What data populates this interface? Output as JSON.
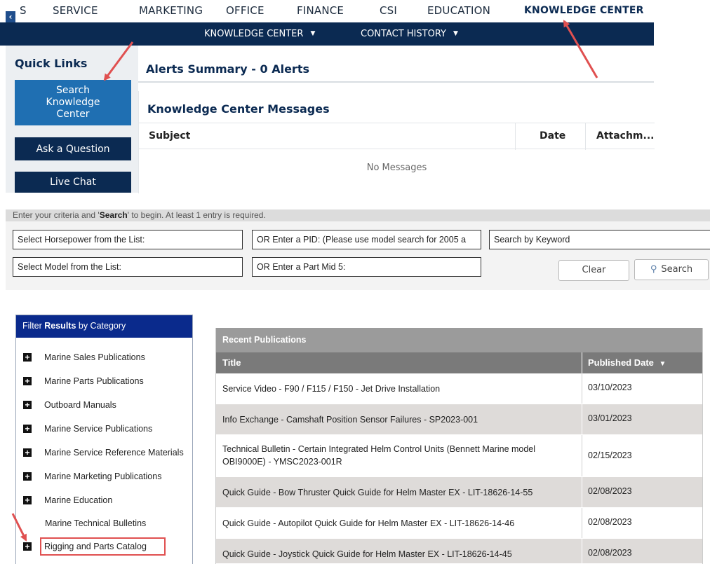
{
  "nav": {
    "items": [
      "S",
      "SERVICE",
      "MARKETING",
      "OFFICE",
      "FINANCE",
      "CSI",
      "EDUCATION",
      "KNOWLEDGE CENTER"
    ],
    "back_icon": "chevron-left-icon"
  },
  "subnav": {
    "items": [
      "KNOWLEDGE CENTER",
      "CONTACT HISTORY"
    ]
  },
  "quick_links": {
    "title": "Quick Links",
    "buttons": [
      "Search Knowledge Center",
      "Ask a Question",
      "Live Chat"
    ]
  },
  "alerts": {
    "title": "Alerts Summary - 0 Alerts"
  },
  "kc_messages": {
    "title": "Knowledge Center Messages",
    "columns": [
      "Subject",
      "Date",
      "Attachm..."
    ],
    "empty_text": "No Messages"
  },
  "search": {
    "hint_prefix": "Enter your criteria and '",
    "hint_bold": "Search",
    "hint_suffix": "' to begin. At least 1 entry is required.",
    "fields": {
      "horsepower": "Select Horsepower from the List:",
      "pid": "OR Enter a PID: (Please use model search for 2005 a",
      "keyword": "Search by Keyword",
      "model": "Select Model from the List:",
      "mid5": "OR Enter a Part Mid 5:"
    },
    "clear_label": "Clear",
    "search_label": "Search"
  },
  "filter": {
    "header_prefix": "Filter ",
    "header_bold": "Results",
    "header_suffix": " by Category",
    "categories": [
      "Marine Sales Publications",
      "Marine Parts Publications",
      "Outboard Manuals",
      "Marine Service Publications",
      "Marine Service Reference Materials",
      "Marine Marketing Publications",
      "Marine Education",
      "Marine Technical Bulletins",
      "Rigging and Parts Catalog"
    ]
  },
  "publications": {
    "caption": "Recent Publications",
    "col_title": "Title",
    "col_date": "Published Date",
    "rows": [
      {
        "title": "Service Video - F90 / F115 / F150 - Jet Drive Installation",
        "date": "03/10/2023"
      },
      {
        "title": "Info Exchange - Camshaft Position Sensor Failures - SP2023-001",
        "date": "03/01/2023"
      },
      {
        "title": "Technical Bulletin - Certain Integrated Helm Control Units (Bennett Marine model OBI9000E) - YMSC2023-001R",
        "date": "02/15/2023"
      },
      {
        "title": "Quick Guide - Bow Thruster Quick Guide for Helm Master EX - LIT-18626-14-55",
        "date": "02/08/2023"
      },
      {
        "title": "Quick Guide - Autopilot Quick Guide for Helm Master EX - LIT-18626-14-46",
        "date": "02/08/2023"
      },
      {
        "title": "Quick Guide - Joystick Quick Guide for Helm Master EX - LIT-18626-14-45",
        "date": "02/08/2023"
      }
    ]
  },
  "colors": {
    "navy": "#0b2a52",
    "button_blue": "#1f6fb2",
    "filter_header": "#0a2a8c",
    "arrow_red": "#e05050"
  }
}
